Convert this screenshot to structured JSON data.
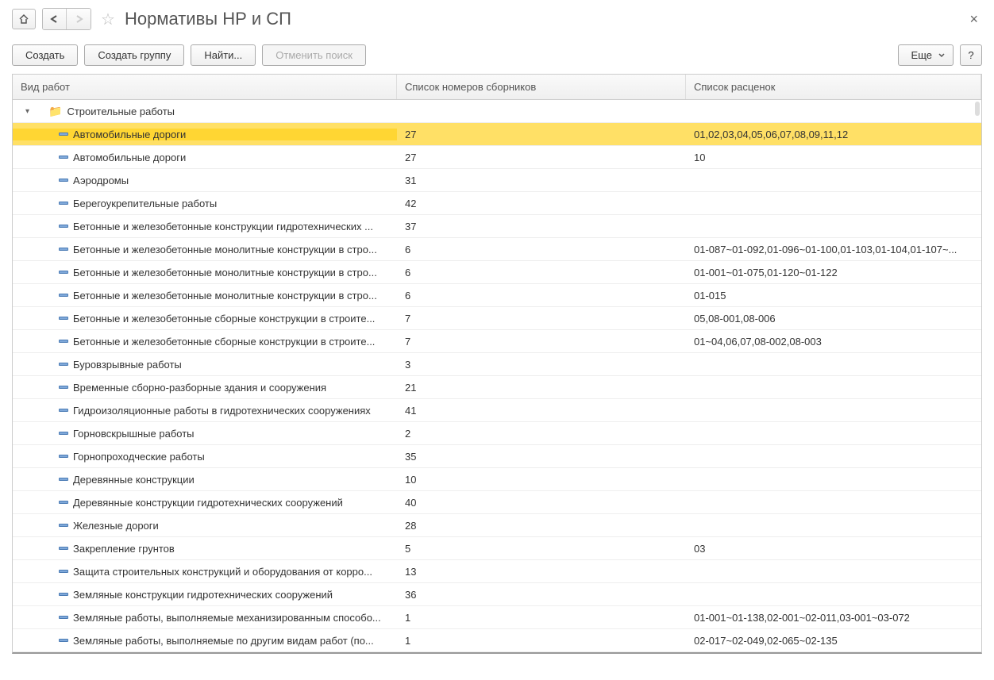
{
  "header": {
    "title": "Нормативы НР и СП"
  },
  "toolbar": {
    "create": "Создать",
    "create_group": "Создать группу",
    "find": "Найти...",
    "cancel_search": "Отменить поиск",
    "more": "Еще",
    "help": "?"
  },
  "columns": {
    "c1": "Вид работ",
    "c2": "Список номеров сборников",
    "c3": "Список расценок"
  },
  "group": {
    "label": "Строительные работы"
  },
  "rows": [
    {
      "name": "Автомобильные дороги",
      "num": "27",
      "rates": "01,02,03,04,05,06,07,08,09,11,12",
      "selected": true
    },
    {
      "name": "Автомобильные дороги",
      "num": "27",
      "rates": "10"
    },
    {
      "name": "Аэродромы",
      "num": "31",
      "rates": ""
    },
    {
      "name": "Берегоукрепительные работы",
      "num": "42",
      "rates": ""
    },
    {
      "name": "Бетонные и железобетонные конструкции гидротехнических ...",
      "num": "37",
      "rates": ""
    },
    {
      "name": "Бетонные и железобетонные монолитные конструкции в стро...",
      "num": "6",
      "rates": "01-087~01-092,01-096~01-100,01-103,01-104,01-107~..."
    },
    {
      "name": "Бетонные и железобетонные монолитные конструкции в стро...",
      "num": "6",
      "rates": "01-001~01-075,01-120~01-122"
    },
    {
      "name": "Бетонные и железобетонные монолитные конструкции в стро...",
      "num": "6",
      "rates": "01-015"
    },
    {
      "name": "Бетонные и железобетонные сборные конструкции в строите...",
      "num": "7",
      "rates": "05,08-001,08-006"
    },
    {
      "name": "Бетонные и железобетонные сборные конструкции в строите...",
      "num": "7",
      "rates": "01~04,06,07,08-002,08-003"
    },
    {
      "name": "Буровзрывные работы",
      "num": "3",
      "rates": ""
    },
    {
      "name": "Временные сборно-разборные здания и сооружения",
      "num": "21",
      "rates": ""
    },
    {
      "name": "Гидроизоляционные работы в гидротехнических сооружениях",
      "num": "41",
      "rates": ""
    },
    {
      "name": "Горновскрышные работы",
      "num": "2",
      "rates": ""
    },
    {
      "name": "Горнопроходческие работы",
      "num": "35",
      "rates": ""
    },
    {
      "name": "Деревянные конструкции",
      "num": "10",
      "rates": ""
    },
    {
      "name": "Деревянные конструкции гидротехнических сооружений",
      "num": "40",
      "rates": ""
    },
    {
      "name": "Железные дороги",
      "num": "28",
      "rates": ""
    },
    {
      "name": "Закрепление грунтов",
      "num": "5",
      "rates": "03"
    },
    {
      "name": "Защита строительных конструкций и оборудования от корро...",
      "num": "13",
      "rates": ""
    },
    {
      "name": "Земляные конструкции гидротехнических сооружений",
      "num": "36",
      "rates": ""
    },
    {
      "name": "Земляные работы, выполняемые механизированным способо...",
      "num": "1",
      "rates": "01-001~01-138,02-001~02-011,03-001~03-072"
    },
    {
      "name": "Земляные работы, выполняемые по другим видам работ (по...",
      "num": "1",
      "rates": "02-017~02-049,02-065~02-135"
    }
  ]
}
